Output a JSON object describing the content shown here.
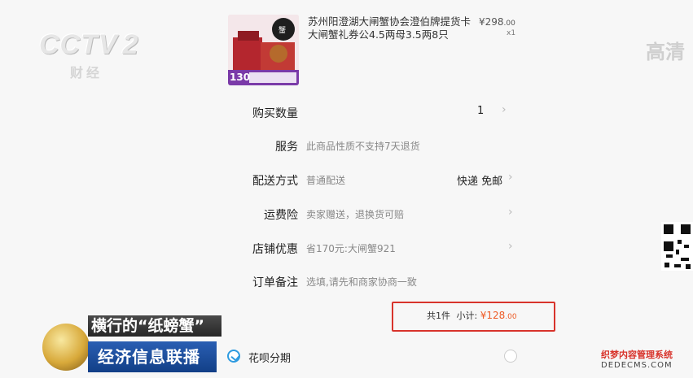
{
  "broadcast": {
    "logo_text": "CCTV",
    "channel_number": "2",
    "channel_sub": "财经",
    "corner_text": "高清",
    "ticker_headline": "横行的“纸螃蟹”",
    "program_name": "经济信息联播"
  },
  "product": {
    "thumbnail_badge": "130",
    "title": "苏州阳澄湖大闸蟹协会澄伯牌提货卡大闸蟹礼券公4.5两母3.5两8只",
    "price_symbol": "¥",
    "price_int": "298",
    "price_cents": ".00",
    "quantity": "x1"
  },
  "order_rows": [
    {
      "label": "购买数量",
      "value": "",
      "right": "1",
      "chevron": "›"
    },
    {
      "label": "服务",
      "value": "此商品性质不支持7天退货",
      "right": "",
      "chevron": ""
    },
    {
      "label": "配送方式",
      "value": "普通配送",
      "right": "快递 免邮",
      "chevron": "›"
    },
    {
      "label": "运费险",
      "value": "卖家赠送，退换货可赔",
      "right": "",
      "chevron": "›"
    },
    {
      "label": "店铺优惠",
      "value": "省170元:大闸蟹921",
      "right": "",
      "chevron": "›"
    },
    {
      "label": "订单备注",
      "value": "选填,请先和商家协商一致",
      "right": "",
      "chevron": ""
    }
  ],
  "subtotal": {
    "count_text": "共1件",
    "label": "小计:",
    "symbol": "¥",
    "amount_int": "128",
    "amount_cents": ".00"
  },
  "payment": {
    "huabei_label": "花呗分期"
  },
  "watermark": {
    "line1": "织梦内容管理系统",
    "line2": "DEDECMS.COM"
  },
  "colors": {
    "accent_price": "#ee5a24",
    "highlight_box": "#d8332b",
    "huabei_blue": "#2e9be0"
  }
}
